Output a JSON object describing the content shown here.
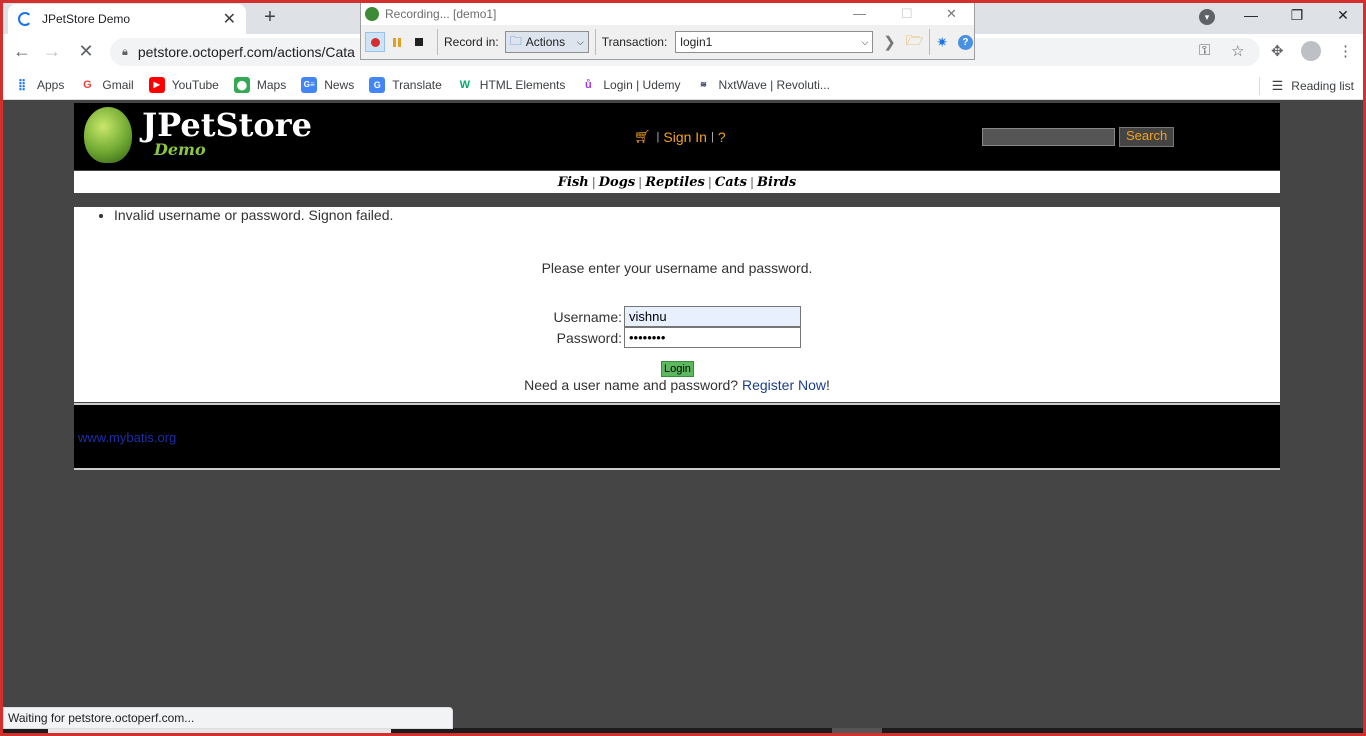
{
  "browser": {
    "tab_title": "JPetStore Demo",
    "tab_close": "✕",
    "new_tab": "+",
    "url": "petstore.octoperf.com/actions/Cata",
    "win_min": "—",
    "win_max": "❐",
    "win_close": "✕",
    "bookmarks": [
      {
        "label": "Apps",
        "icon": "apps-icon",
        "color": "#1a73e8"
      },
      {
        "label": "Gmail",
        "icon": "gmail-icon",
        "color": "#ea4335"
      },
      {
        "label": "YouTube",
        "icon": "youtube-icon",
        "color": "#ff0000"
      },
      {
        "label": "Maps",
        "icon": "maps-icon",
        "color": "#34a853"
      },
      {
        "label": "News",
        "icon": "news-icon",
        "color": "#4285f4"
      },
      {
        "label": "Translate",
        "icon": "translate-icon",
        "color": "#4285f4"
      },
      {
        "label": "HTML Elements",
        "icon": "w3schools-icon",
        "color": "#04aa6d"
      },
      {
        "label": "Login | Udemy",
        "icon": "udemy-icon",
        "color": "#a435f0"
      },
      {
        "label": "NxtWave | Revoluti...",
        "icon": "nxtwave-icon",
        "color": "#1b2a4e"
      }
    ],
    "reading_list": "Reading list",
    "status": "Waiting for petstore.octoperf.com..."
  },
  "recorder": {
    "title": "Recording... [demo1]",
    "record_in_label": "Record in:",
    "record_in_value": "Actions",
    "transaction_label": "Transaction:",
    "transaction_value": "login1",
    "min": "—",
    "max": "☐",
    "close": "✕"
  },
  "site": {
    "logo_title": "JPetStore",
    "logo_sub": "Demo",
    "sign_in": "Sign In",
    "help": "?",
    "search_button": "Search",
    "search_value": "",
    "categories": [
      "Fish",
      "Dogs",
      "Reptiles",
      "Cats",
      "Birds"
    ],
    "error_message": "Invalid username or password. Signon failed.",
    "prompt": "Please enter your username and password.",
    "username_label": "Username:",
    "username_value": "vishnu",
    "password_label": "Password:",
    "password_value": "••••••••",
    "login_button": "Login",
    "register_prefix": "Need a user name and password?",
    "register_link": "Register Now",
    "register_suffix": "!",
    "footer_link": "www.mybatis.org"
  },
  "colors": {
    "accent_orange": "#f4a21a",
    "recording_frame": "#d32f2f",
    "login_green": "#5cb85c"
  }
}
